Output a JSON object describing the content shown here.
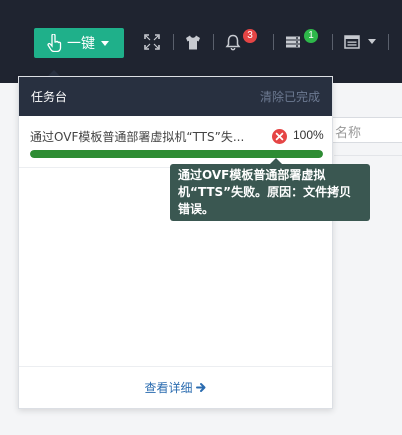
{
  "toolbar": {
    "one_key_label": "一键",
    "icons": [
      "hand-icon",
      "fullscreen-icon",
      "tshirt-icon",
      "bell-icon",
      "server-icon",
      "window-icon"
    ],
    "notification_count": "3",
    "server_count": "1"
  },
  "background": {
    "search_placeholder": "名称"
  },
  "task_panel": {
    "title": "任务台",
    "clear_label": "清除已完成",
    "tasks": [
      {
        "name": "通过OVF模板普通部署虚拟机“TTS”失...",
        "percent": "100%",
        "progress": 1.0,
        "status": "failed"
      }
    ],
    "details_label": "查看详细"
  },
  "tooltip": {
    "text": "通过OVF模板普通部署虚拟机“TTS”失败。原因：文件拷贝错误。"
  },
  "colors": {
    "topbar": "#1f2430",
    "accent_green": "#1fb08a",
    "progress_green": "#2e8c33",
    "error_red": "#e54545",
    "tooltip_bg": "#3a5751",
    "link_blue": "#2b6cb0"
  }
}
